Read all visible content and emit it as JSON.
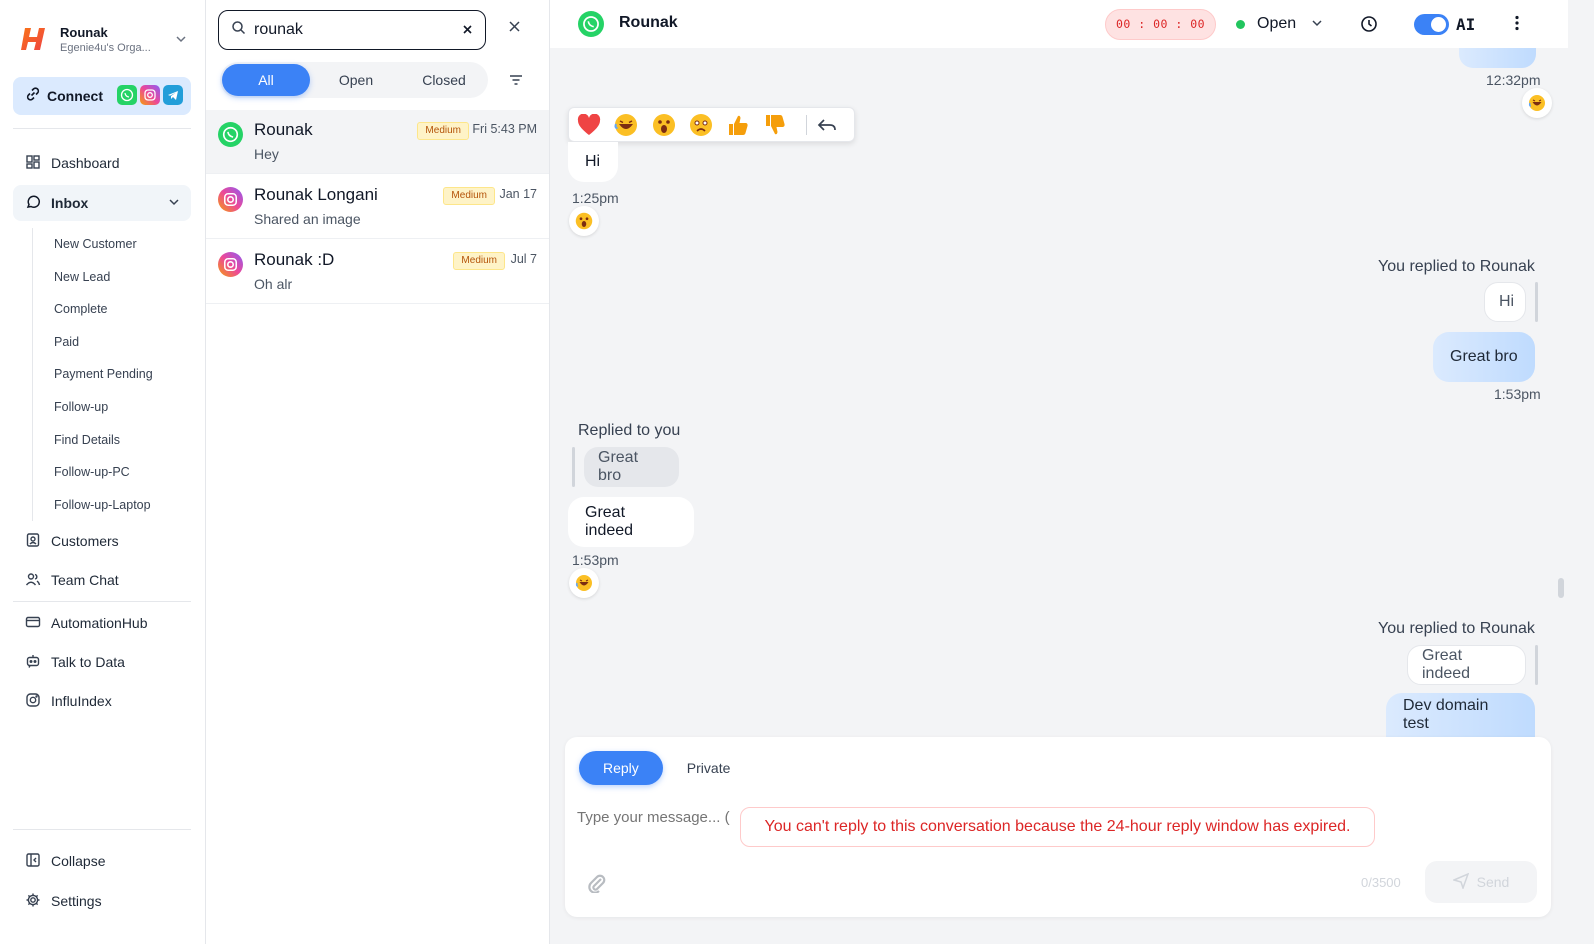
{
  "org": {
    "name": "Rounak",
    "subtitle": "Egenie4u's Orga..."
  },
  "connect": {
    "label": "Connect"
  },
  "nav": {
    "dashboard": "Dashboard",
    "inbox": "Inbox",
    "inbox_sub": [
      "New Customer",
      "New Lead",
      "Complete",
      "Paid",
      "Payment Pending",
      "Follow-up",
      "Find Details",
      "Follow-up-PC",
      "Follow-up-Laptop"
    ],
    "customers": "Customers",
    "team_chat": "Team Chat",
    "automation_hub": "AutomationHub",
    "talk_to_data": "Talk to Data",
    "influindex": "InfluIndex",
    "collapse": "Collapse",
    "settings": "Settings"
  },
  "search": {
    "value": "rounak"
  },
  "filters": {
    "all": "All",
    "open": "Open",
    "closed": "Closed"
  },
  "conversations": [
    {
      "name": "Rounak",
      "preview": "Hey",
      "priority": "Medium",
      "time": "Fri 5:43 PM",
      "channel": "whatsapp"
    },
    {
      "name": "Rounak Longani",
      "preview": "Shared an image",
      "priority": "Medium",
      "time": "Jan 17",
      "channel": "instagram"
    },
    {
      "name": "Rounak :D",
      "preview": "Oh alr",
      "priority": "Medium",
      "time": "Jul 7",
      "channel": "instagram"
    }
  ],
  "chat": {
    "contact_name": "Rounak",
    "timer": "00 : 00 : 00",
    "status": "Open",
    "ai_label": "AI",
    "ai_enabled": true,
    "reactions": [
      "heart",
      "laughing",
      "surprised",
      "sad",
      "thumbs-up",
      "thumbs-down"
    ],
    "messages": {
      "t_1232": "12:32pm",
      "hi_in": "Hi",
      "t_125": "1:25pm",
      "you_replied_1": "You replied to Rounak",
      "quoted_hi": "Hi",
      "great_bro_out": "Great bro",
      "t_153_a": "1:53pm",
      "replied_to_you": "Replied to you",
      "quoted_great_bro": "Great bro",
      "great_indeed_in": "Great indeed",
      "t_153_b": "1:53pm",
      "you_replied_2": "You replied to Rounak",
      "quoted_great_indeed": "Great indeed",
      "dev_domain_out": "Dev domain test"
    }
  },
  "composer": {
    "reply_tab": "Reply",
    "private_tab": "Private",
    "placeholder": "Type your message... (",
    "expired_notice": "You can't reply to this conversation because the 24-hour reply window has expired.",
    "counter": "0/3500",
    "send": "Send"
  },
  "colors": {
    "accent": "#3b82f6",
    "danger": "#dc2626",
    "whatsapp": "#25d366",
    "badge_bg": "#fef3c7"
  }
}
